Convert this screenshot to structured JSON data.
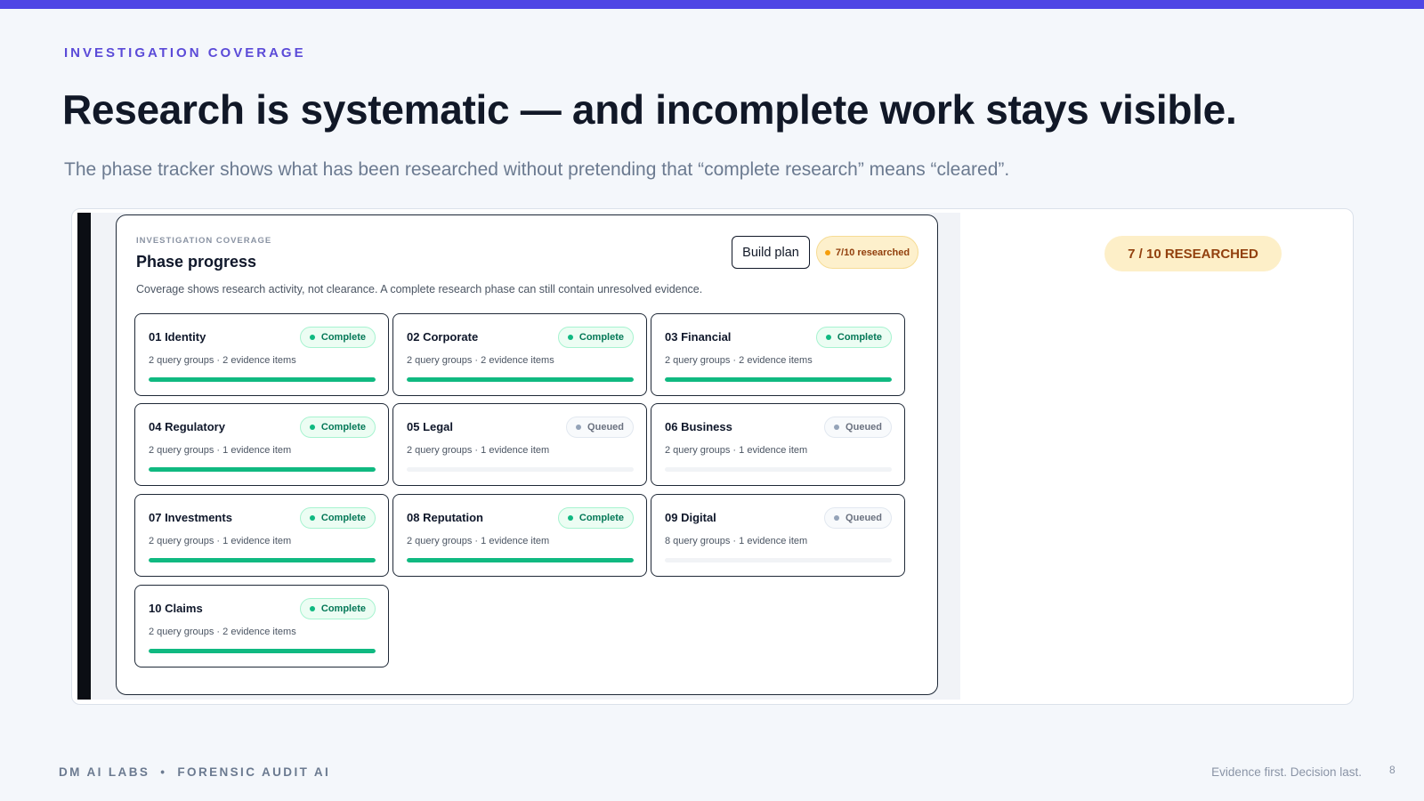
{
  "slide": {
    "eyebrow": "INVESTIGATION COVERAGE",
    "title": "Research is systematic — and incomplete work stays visible.",
    "subtitle": "The phase tracker shows what has been researched without pretending that “complete research” means “cleared”.",
    "accent_color": "#4f46e5"
  },
  "panel": {
    "eyebrow": "INVESTIGATION COVERAGE",
    "title": "Phase progress",
    "description": "Coverage shows research activity, not clearance. A complete research phase can still contain unresolved evidence.",
    "build_plan_label": "Build plan",
    "researched_pill": "7/10 researched",
    "phases": [
      {
        "name": "01 Identity",
        "meta": "2 query groups · 2 evidence items",
        "status": "Complete",
        "progress": 1.0
      },
      {
        "name": "02 Corporate",
        "meta": "2 query groups · 2 evidence items",
        "status": "Complete",
        "progress": 1.0
      },
      {
        "name": "03 Financial",
        "meta": "2 query groups · 2 evidence items",
        "status": "Complete",
        "progress": 1.0
      },
      {
        "name": "04 Regulatory",
        "meta": "2 query groups · 1 evidence item",
        "status": "Complete",
        "progress": 1.0
      },
      {
        "name": "05 Legal",
        "meta": "2 query groups · 1 evidence item",
        "status": "Queued",
        "progress": 0.0
      },
      {
        "name": "06 Business",
        "meta": "2 query groups · 1 evidence item",
        "status": "Queued",
        "progress": 0.0
      },
      {
        "name": "07 Investments",
        "meta": "2 query groups · 1 evidence item",
        "status": "Complete",
        "progress": 1.0
      },
      {
        "name": "08 Reputation",
        "meta": "2 query groups · 1 evidence item",
        "status": "Complete",
        "progress": 1.0
      },
      {
        "name": "09 Digital",
        "meta": "8 query groups · 1 evidence item",
        "status": "Queued",
        "progress": 0.0
      },
      {
        "name": "10 Claims",
        "meta": "2 query groups · 2 evidence items",
        "status": "Complete",
        "progress": 1.0
      }
    ]
  },
  "right_badge": "7 / 10 RESEARCHED",
  "footer": {
    "brand": "DM AI LABS",
    "separator": "•",
    "product": "FORENSIC AUDIT AI",
    "tagline": "Evidence first. Decision last.",
    "page_number": "8"
  }
}
